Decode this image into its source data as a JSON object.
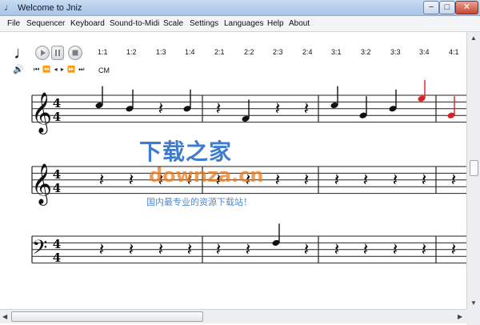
{
  "window": {
    "title": "Welcome to Jniz",
    "app_icon": "music-note-icon",
    "buttons": {
      "minimize": "−",
      "maximize": "□",
      "close": "✕"
    }
  },
  "menu": [
    "File",
    "Sequencer",
    "Keyboard",
    "Sound-to-Midi",
    "Scale",
    "Settings",
    "Languages",
    "Help",
    "About"
  ],
  "toolbar": {
    "note_glyph": "♩",
    "volume_glyph": "🔊",
    "nav_glyphs": "⏮ ⏪ ◂ ▸ ⏩ ⏭",
    "key_label": "CM",
    "ratios": [
      "1:1",
      "1:2",
      "1:3",
      "1:4",
      "2:1",
      "2:2",
      "2:3",
      "2:4",
      "3:1",
      "3:2",
      "3:3",
      "3:4",
      "4:1"
    ]
  },
  "score": {
    "time_signature": {
      "top": "4",
      "bottom": "4"
    },
    "treble_clef": "𝄞",
    "bass_clef": "𝄢",
    "rest_glyph": "𝄽",
    "highlight_color": "#e02020"
  },
  "watermark": {
    "title": "下载之家",
    "site": "downza.cn",
    "slogan": "国内最专业的资源下载站！"
  }
}
